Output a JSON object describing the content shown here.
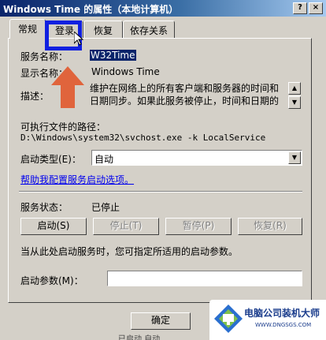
{
  "window": {
    "title": "Windows Time 的属性（本地计算机）",
    "help_glyph": "?",
    "close_glyph": "×"
  },
  "tabs": [
    {
      "label": "常规",
      "active": true
    },
    {
      "label": "登录",
      "active": false
    },
    {
      "label": "恢复",
      "active": false
    },
    {
      "label": "依存关系",
      "active": false
    }
  ],
  "general": {
    "service_name_label": "服务名称：",
    "service_name_value": "W32Time",
    "display_name_label": "显示名称：",
    "display_name_value": "Windows Time",
    "description_label": "描述：",
    "description_lines": [
      "维护在网络上的所有客户端和服务器的时间和",
      "日期同步。如果此服务被停止，时间和日期的"
    ],
    "path_label": "可执行文件的路径：",
    "path_value": "D:\\Windows\\system32\\svchost.exe -k LocalService",
    "startup_type_label": "启动类型(E)：",
    "startup_type_value": "自动",
    "help_link": "帮助我配置服务启动选项。",
    "status_label": "服务状态：",
    "status_value": "已停止",
    "buttons": {
      "start": "启动(S)",
      "stop": "停止(T)",
      "pause": "暂停(P)",
      "resume": "恢复(R)"
    },
    "hint": "当从此处启动服务时，您可指定所适用的启动参数。",
    "params_label": "启动参数(M)：",
    "params_value": ""
  },
  "footer": {
    "ok": "确定"
  },
  "bottom_fragment": "已启动   自动",
  "watermark": {
    "title": "电脑公司装机大师",
    "url": "WWW.DNGSGS.COM"
  },
  "colors": {
    "highlight": "#1020e0",
    "arrow": "#e0643c",
    "link": "#0000ee"
  }
}
